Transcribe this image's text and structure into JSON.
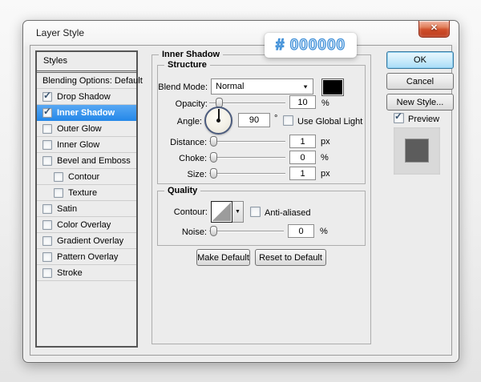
{
  "window": {
    "title": "Layer Style"
  },
  "icons": {
    "close": "✕",
    "check": "✓",
    "dropdown_arrow": "▼"
  },
  "tooltip": {
    "text": "# 000000"
  },
  "sidebar": {
    "header": "Styles",
    "items": [
      {
        "label": "Blending Options: Default",
        "checked": null,
        "selected": false
      },
      {
        "label": "Drop Shadow",
        "checked": true,
        "selected": false
      },
      {
        "label": "Inner Shadow",
        "checked": true,
        "selected": true
      },
      {
        "label": "Outer Glow",
        "checked": false,
        "selected": false
      },
      {
        "label": "Inner Glow",
        "checked": false,
        "selected": false
      },
      {
        "label": "Bevel and Emboss",
        "checked": false,
        "selected": false
      },
      {
        "label": "Contour",
        "checked": false,
        "selected": false,
        "indent": true
      },
      {
        "label": "Texture",
        "checked": false,
        "selected": false,
        "indent": true
      },
      {
        "label": "Satin",
        "checked": false,
        "selected": false
      },
      {
        "label": "Color Overlay",
        "checked": false,
        "selected": false
      },
      {
        "label": "Gradient Overlay",
        "checked": false,
        "selected": false
      },
      {
        "label": "Pattern Overlay",
        "checked": false,
        "selected": false
      },
      {
        "label": "Stroke",
        "checked": false,
        "selected": false
      }
    ]
  },
  "panel": {
    "title": "Inner Shadow",
    "structure": {
      "legend": "Structure",
      "blend_mode_label": "Blend Mode:",
      "blend_mode_value": "Normal",
      "opacity_label": "Opacity:",
      "opacity_value": "10",
      "opacity_unit": "%",
      "angle_label": "Angle:",
      "angle_value": "90",
      "angle_unit": "°",
      "use_global_light_label": "Use Global Light",
      "distance_label": "Distance:",
      "distance_value": "1",
      "distance_unit": "px",
      "choke_label": "Choke:",
      "choke_value": "0",
      "choke_unit": "%",
      "size_label": "Size:",
      "size_value": "1",
      "size_unit": "px"
    },
    "quality": {
      "legend": "Quality",
      "contour_label": "Contour:",
      "anti_aliased_label": "Anti-aliased",
      "noise_label": "Noise:",
      "noise_value": "0",
      "noise_unit": "%"
    },
    "footer_buttons": {
      "make_default": "Make Default",
      "reset_to_default": "Reset to Default"
    }
  },
  "actions": {
    "ok": "OK",
    "cancel": "Cancel",
    "new_style": "New Style...",
    "preview_label": "Preview"
  },
  "colors": {
    "selection_blue": "#2f96ef",
    "blend_swatch": "#000000",
    "preview_outer": "#d9d9d9",
    "preview_inner": "#5c5c5c",
    "tooltip_blue": "#4090d8",
    "close_red": "#c9401f"
  }
}
